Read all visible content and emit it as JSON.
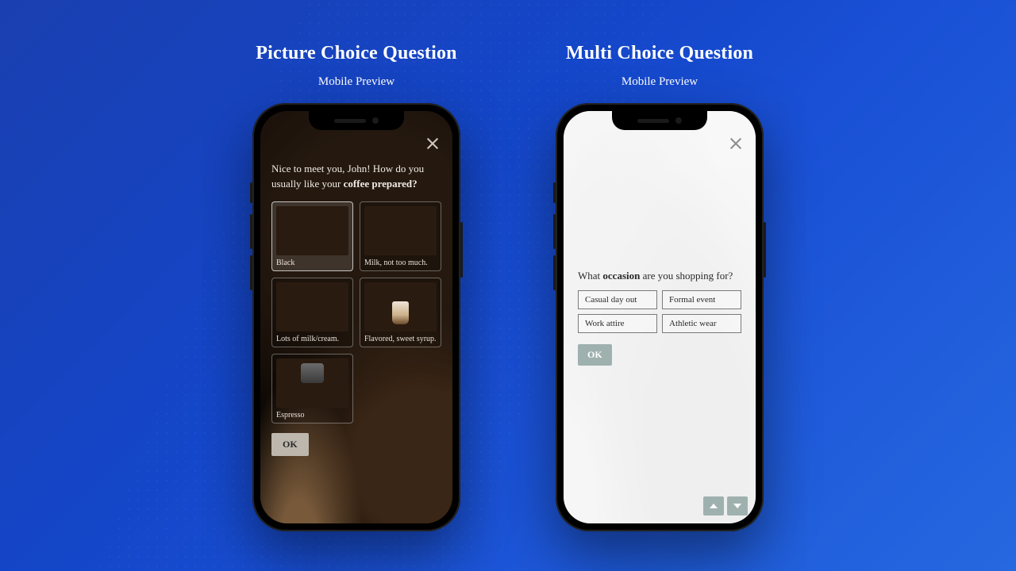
{
  "left": {
    "title": "Picture Choice Question",
    "subtitle": "Mobile Preview",
    "question_pre": "Nice to meet you, John! How do you usually like your ",
    "question_bold": "coffee prepared?",
    "options": [
      {
        "label": "Black"
      },
      {
        "label": "Milk, not too much."
      },
      {
        "label": "Lots of milk/cream."
      },
      {
        "label": "Flavored, sweet syrup."
      },
      {
        "label": "Espresso"
      }
    ],
    "ok": "OK"
  },
  "right": {
    "title": "Multi Choice Question",
    "subtitle": "Mobile Preview",
    "question_pre": "What ",
    "question_bold": "occasion",
    "question_post": " are you shopping for?",
    "options": [
      {
        "label": "Casual day out"
      },
      {
        "label": "Formal event"
      },
      {
        "label": "Work attire"
      },
      {
        "label": "Athletic wear"
      }
    ],
    "ok": "OK"
  }
}
